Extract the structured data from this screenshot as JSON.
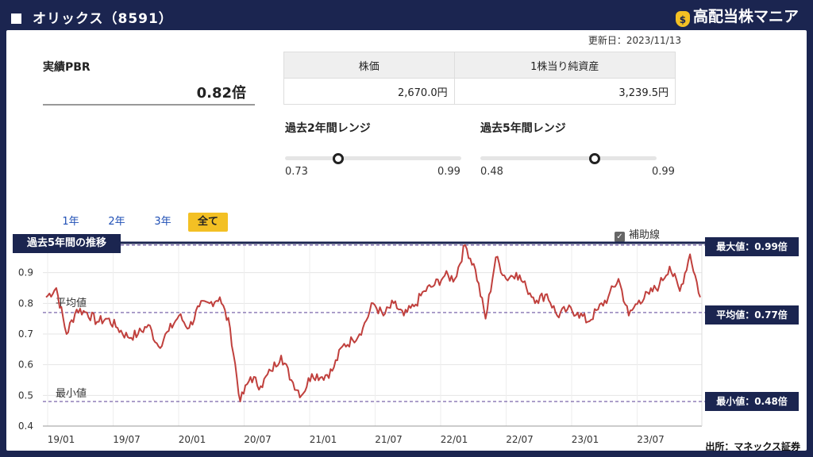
{
  "header": {
    "title": "オリックス（8591）",
    "brand": "高配当株マニア",
    "brand_icon": "money-bag-icon"
  },
  "updated": "更新日：2023/11/13",
  "pbr": {
    "label": "実績PBR",
    "value": "0.82倍"
  },
  "info_table": {
    "headers": [
      "株価",
      "1株当り純資産"
    ],
    "values": [
      "2,670.0円",
      "3,239.5円"
    ]
  },
  "ranges": [
    {
      "title": "過去2年間レンジ",
      "min": "0.73",
      "max": "0.99",
      "position": 0.3
    },
    {
      "title": "過去5年間レンジ",
      "min": "0.48",
      "max": "0.99",
      "position": 0.65
    }
  ],
  "tabs": [
    {
      "label": "1年",
      "active": false
    },
    {
      "label": "2年",
      "active": false
    },
    {
      "label": "3年",
      "active": false
    },
    {
      "label": "全て",
      "active": true
    }
  ],
  "helper_lines": {
    "label": "補助線",
    "checked": true
  },
  "chart_title": "過去5年間の推移",
  "annotations": {
    "avg": "平均値",
    "min": "最小値"
  },
  "side_labels": {
    "max": "最大値：0.99倍",
    "avg": "平均値：0.77倍",
    "min": "最小値：0.48倍"
  },
  "source": "出所：マネックス証券",
  "colors": {
    "navy": "#1b2550",
    "line": "#c0403d",
    "accent": "#f3c024",
    "ref": "#6b55a0"
  },
  "chart_data": {
    "type": "line",
    "title": "過去5年間の推移",
    "ylim": [
      0.4,
      1.0
    ],
    "yticks": [
      "0.4",
      "0.5",
      "0.6",
      "0.7",
      "0.8",
      "0.9"
    ],
    "xticks": [
      "19/01",
      "19/07",
      "20/01",
      "20/07",
      "21/01",
      "21/07",
      "22/01",
      "22/07",
      "23/01",
      "23/07"
    ],
    "xlim": [
      "2018-11",
      "2023-11"
    ],
    "reference_lines": {
      "max": 0.99,
      "avg": 0.77,
      "min": 0.48
    },
    "series": [
      {
        "dates": [
          "2018-11",
          "2018-12",
          "2018-12b",
          "2019-01",
          "2019-01b",
          "2019-02",
          "2019-03",
          "2019-04",
          "2019-05",
          "2019-06",
          "2019-07",
          "2019-08",
          "2019-09",
          "2019-10",
          "2019-11",
          "2019-12",
          "2020-01",
          "2020-02",
          "2020-03",
          "2020-03b",
          "2020-04",
          "2020-05",
          "2020-06",
          "2020-07",
          "2020-08",
          "2020-09",
          "2020-10",
          "2020-11",
          "2020-12",
          "2021-01",
          "2021-02",
          "2021-03",
          "2021-04",
          "2021-05",
          "2021-06",
          "2021-07",
          "2021-08",
          "2021-09",
          "2021-10",
          "2021-11",
          "2021-12",
          "2022-01",
          "2022-01b",
          "2022-02",
          "2022-03",
          "2022-04",
          "2022-05",
          "2022-06",
          "2022-07",
          "2022-08",
          "2022-09",
          "2022-10",
          "2022-11",
          "2022-12",
          "2023-01",
          "2023-02",
          "2023-03",
          "2023-04",
          "2023-05",
          "2023-06",
          "2023-07",
          "2023-08",
          "2023-09",
          "2023-10",
          "2023-11"
        ],
        "values": [
          0.82,
          0.85,
          0.7,
          0.78,
          0.77,
          0.74,
          0.75,
          0.72,
          0.69,
          0.7,
          0.73,
          0.66,
          0.71,
          0.76,
          0.72,
          0.79,
          0.8,
          0.82,
          0.72,
          0.48,
          0.56,
          0.53,
          0.58,
          0.63,
          0.55,
          0.5,
          0.57,
          0.56,
          0.58,
          0.66,
          0.68,
          0.72,
          0.8,
          0.76,
          0.8,
          0.76,
          0.79,
          0.84,
          0.86,
          0.89,
          0.88,
          0.99,
          0.91,
          0.75,
          0.95,
          0.88,
          0.9,
          0.85,
          0.81,
          0.83,
          0.76,
          0.78,
          0.77,
          0.74,
          0.78,
          0.82,
          0.88,
          0.76,
          0.81,
          0.83,
          0.86,
          0.92,
          0.84,
          0.96,
          0.82
        ]
      }
    ]
  }
}
